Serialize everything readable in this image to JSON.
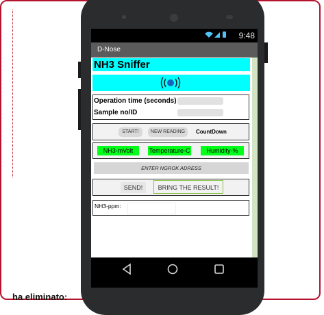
{
  "page": {
    "caption": "ha eliminato:"
  },
  "phone": {
    "status_bar": {
      "time": "9:48",
      "icons": "wifi-icon signal-icon battery-icon"
    },
    "action_bar": {
      "app_title": "D-Nose"
    },
    "app": {
      "title": "NH3 Sniffer",
      "logo_icon": "wireless-broadcast-icon",
      "operation_time_label": "Operation time (seconds)",
      "sample_label": "Sample no/ID",
      "operation_time_value": "",
      "sample_value": "",
      "buttons": {
        "start": "START!",
        "new_reading": "NEW READING",
        "countdown": "CountDown"
      },
      "readings": {
        "nh3": "NH3-mVolt",
        "temperature": "Temperature-C",
        "humidity": "Humidity-%"
      },
      "ngrok_placeholder": "ENTER NGROK ADRESS",
      "send": "SEND!",
      "bring_result": "BRING THE RESULT!",
      "ppm_label": "NH3-ppm:",
      "ppm_value": ""
    },
    "nav_bar": {
      "back_icon": "back-triangle-icon",
      "home_icon": "home-circle-icon",
      "recent_icon": "recent-apps-square-icon"
    }
  },
  "colors": {
    "frame": "#b5122e",
    "cyan": "#00ffff",
    "green": "#00ff19"
  }
}
